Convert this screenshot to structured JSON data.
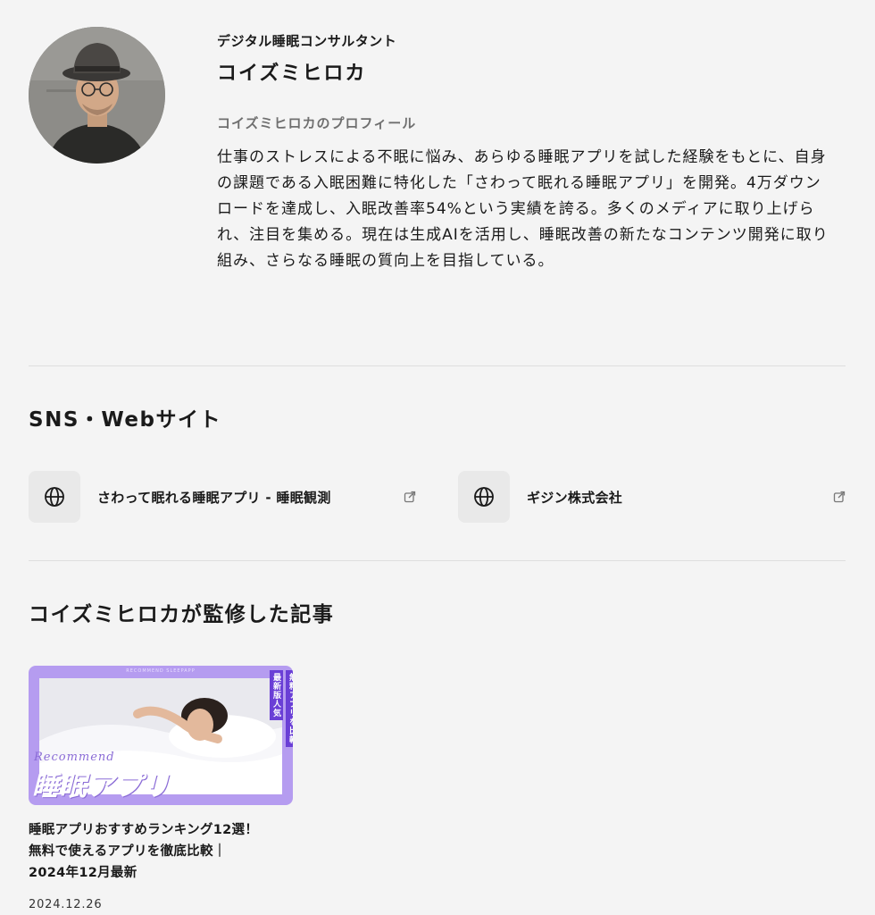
{
  "profile": {
    "role": "デジタル睡眠コンサルタント",
    "name": "コイズミヒロカ",
    "heading": "コイズミヒロカのプロフィール",
    "bio": "仕事のストレスによる不眠に悩み、あらゆる睡眠アプリを試した経験をもとに、自身の課題である入眠困難に特化した「さわって眠れる睡眠アプリ」を開発。4万ダウンロードを達成し、入眠改善率54%という実績を誇る。多くのメディアに取り上げられ、注目を集める。現在は生成AIを活用し、睡眠改善の新たなコンテンツ開発に取り組み、さらなる睡眠の質向上を目指している。"
  },
  "sns": {
    "title": "SNS・Webサイト",
    "links": [
      {
        "label": "さわって眠れる睡眠アプリ - 睡眠観測",
        "icon": "globe-icon"
      },
      {
        "label": "ギジン株式会社",
        "icon": "globe-icon"
      }
    ]
  },
  "articles": {
    "title": "コイズミヒロカが監修した記事",
    "items": [
      {
        "thumb_top": "RECOMMEND SLEEPAPP",
        "thumb_tag_1": "最新版人気",
        "thumb_tag_2": "無料アプリを比較",
        "thumb_script": "Recommend",
        "thumb_big": "睡眠アプリ",
        "title_line1": "睡眠アプリおすすめランキング12選！",
        "title_line2": "無料で使えるアプリを徹底比較｜",
        "title_line3": "2024年12月最新",
        "date": "2024.12.26"
      }
    ]
  },
  "colors": {
    "background": "#f4f4f4",
    "thumb_purple": "#b59cf0",
    "tag_purple": "#6a3fd6"
  }
}
